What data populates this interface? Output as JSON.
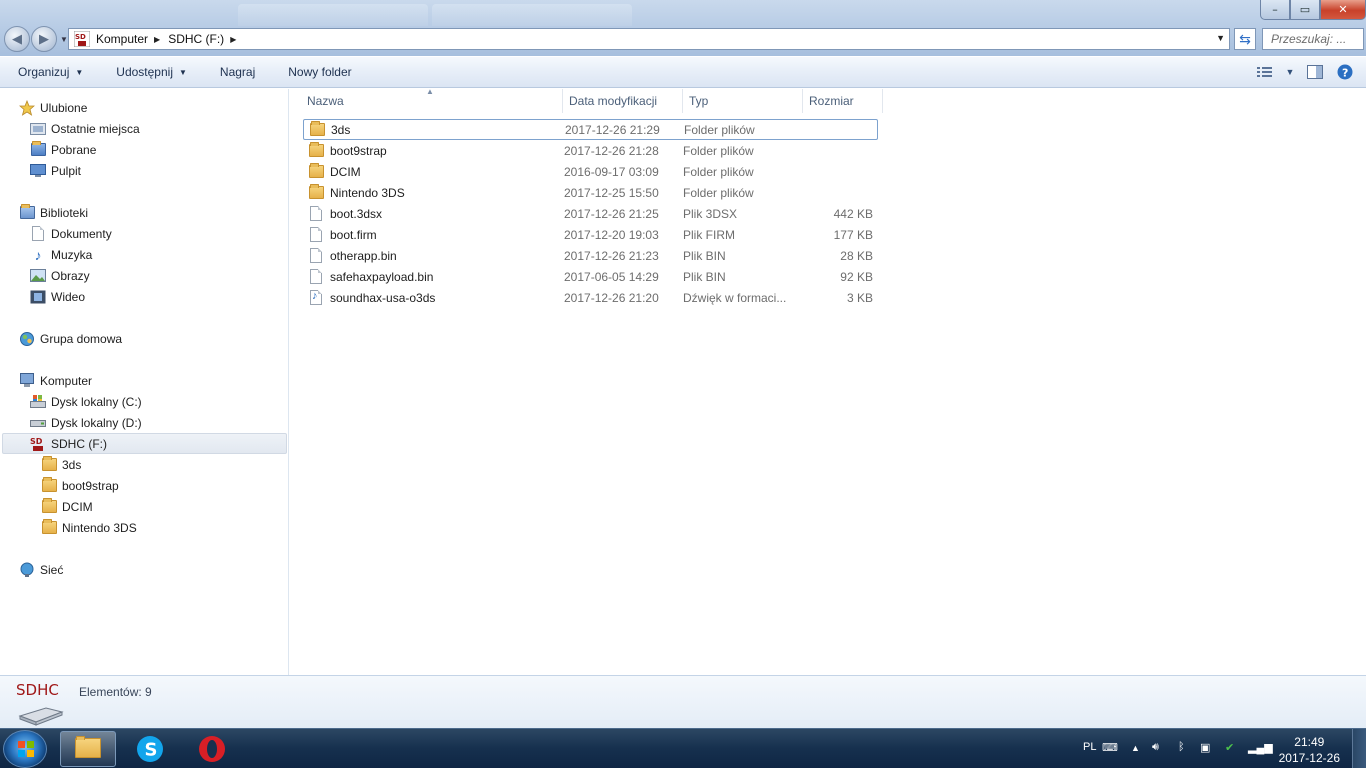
{
  "window": {
    "buttons": {
      "minimize": "–",
      "maximize": "▭",
      "close": "✕"
    }
  },
  "address": {
    "crumbs": [
      "Komputer",
      "SDHC (F:)"
    ],
    "search_placeholder": "Przeszukaj: ..."
  },
  "toolbar": {
    "organize": "Organizuj",
    "share": "Udostępnij",
    "burn": "Nagraj",
    "new_folder": "Nowy folder"
  },
  "nav": {
    "favorites": {
      "label": "Ulubione",
      "items": [
        "Ostatnie miejsca",
        "Pobrane",
        "Pulpit"
      ]
    },
    "libraries": {
      "label": "Biblioteki",
      "items": [
        "Dokumenty",
        "Muzyka",
        "Obrazy",
        "Wideo"
      ]
    },
    "homegroup": "Grupa domowa",
    "computer": {
      "label": "Komputer",
      "drives": [
        "Dysk lokalny (C:)",
        "Dysk lokalny (D:)",
        "SDHC (F:)"
      ],
      "sd_folders": [
        "3ds",
        "boot9strap",
        "DCIM",
        "Nintendo 3DS"
      ]
    },
    "network": "Sieć"
  },
  "columns": [
    "Nazwa",
    "Data modyfikacji",
    "Typ",
    "Rozmiar"
  ],
  "files": [
    {
      "name": "3ds",
      "date": "2017-12-26 21:29",
      "type": "Folder plików",
      "size": "",
      "icon": "folder-icon",
      "selected": true
    },
    {
      "name": "boot9strap",
      "date": "2017-12-26 21:28",
      "type": "Folder plików",
      "size": "",
      "icon": "folder-icon"
    },
    {
      "name": "DCIM",
      "date": "2016-09-17 03:09",
      "type": "Folder plików",
      "size": "",
      "icon": "folder-icon"
    },
    {
      "name": "Nintendo 3DS",
      "date": "2017-12-25 15:50",
      "type": "Folder plików",
      "size": "",
      "icon": "folder-icon"
    },
    {
      "name": "boot.3dsx",
      "date": "2017-12-26 21:25",
      "type": "Plik 3DSX",
      "size": "442 KB",
      "icon": "file-icon"
    },
    {
      "name": "boot.firm",
      "date": "2017-12-20 19:03",
      "type": "Plik FIRM",
      "size": "177 KB",
      "icon": "file-icon"
    },
    {
      "name": "otherapp.bin",
      "date": "2017-12-26 21:23",
      "type": "Plik BIN",
      "size": "28 KB",
      "icon": "file-icon"
    },
    {
      "name": "safehaxpayload.bin",
      "date": "2017-06-05 14:29",
      "type": "Plik BIN",
      "size": "92 KB",
      "icon": "file-icon"
    },
    {
      "name": "soundhax-usa-o3ds",
      "date": "2017-12-26 21:20",
      "type": "Dźwięk w formaci...",
      "size": "3 KB",
      "icon": "audio-file-icon"
    }
  ],
  "details": {
    "logo_text": "SDHC",
    "count": "Elementów: 9"
  },
  "taskbar": {
    "language": "PL",
    "time": "21:49",
    "date": "2017-12-26"
  }
}
